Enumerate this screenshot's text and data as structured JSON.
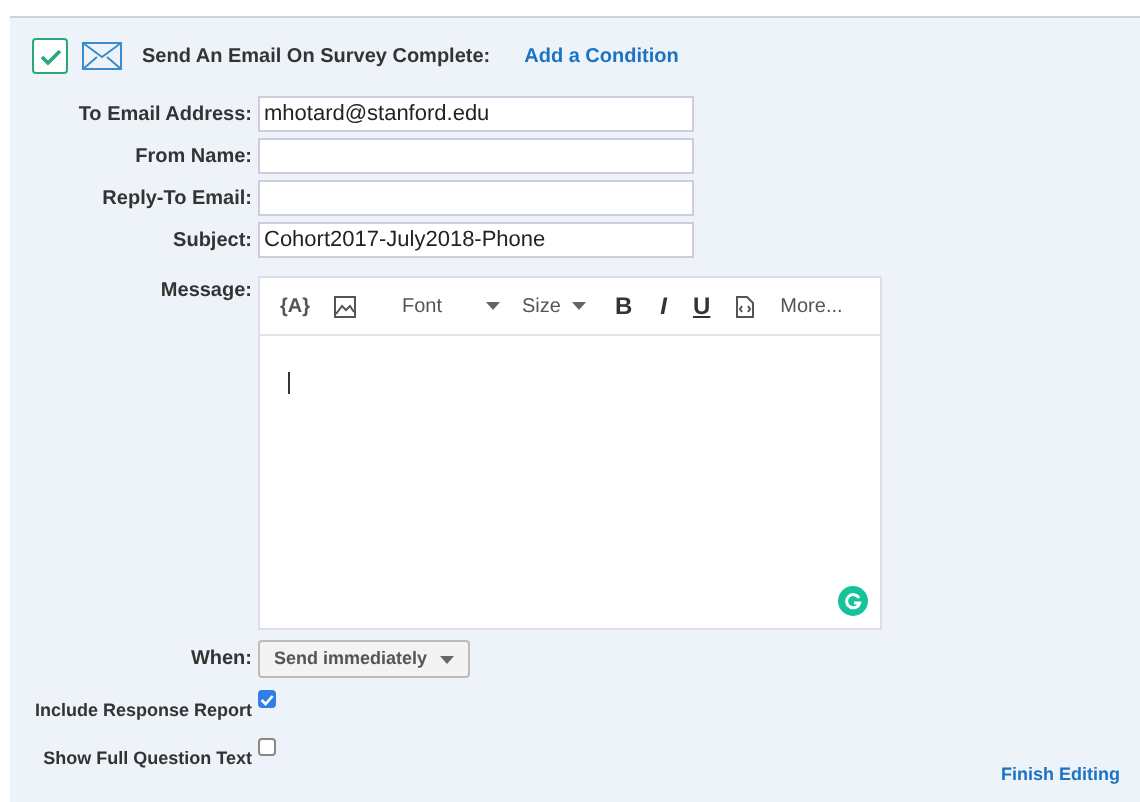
{
  "header": {
    "enabled": true,
    "title": "Send An Email On Survey Complete:",
    "link": "Add a Condition"
  },
  "fields": [
    {
      "label": "To Email Address:",
      "value": "mhotard@stanford.edu"
    },
    {
      "label": "From Name:"
    },
    {
      "label": "Reply-To Email:"
    },
    {
      "label": "Subject:",
      "value": "Cohort2017-July2018-Phone"
    }
  ],
  "message": {
    "label": "Message:",
    "toolbar": {
      "piped_text": "{A}",
      "font": "Font",
      "size": "Size",
      "bold": "B",
      "italic": "I",
      "underline": "U",
      "more": "More..."
    }
  },
  "when": {
    "label": "When:",
    "value": "Send immediately"
  },
  "options": [
    {
      "label": "Include Response Report",
      "checked": true
    },
    {
      "label": "Show Full Question Text",
      "checked": false
    }
  ],
  "footer": {
    "link": "Finish Editing"
  }
}
